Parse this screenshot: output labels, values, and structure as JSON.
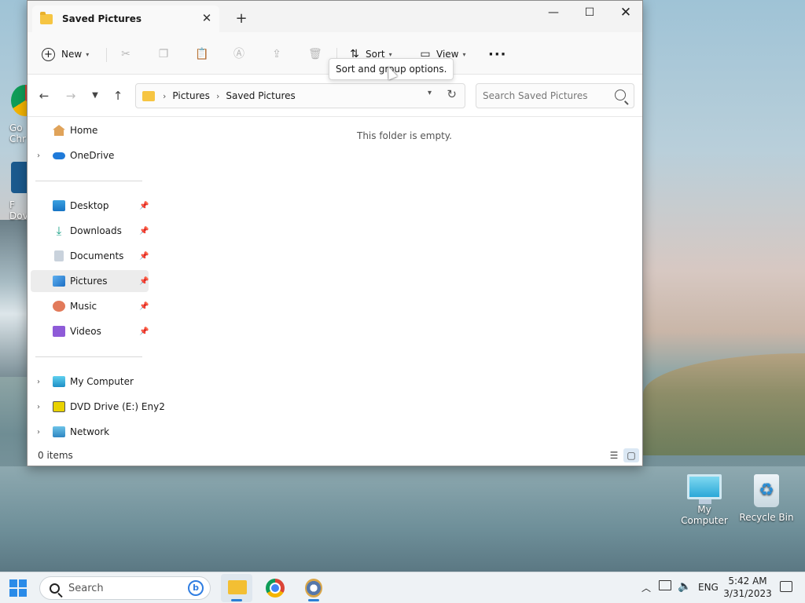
{
  "desktop": {
    "icons": [
      {
        "label": "My Computer"
      },
      {
        "label": "Recycle Bin"
      }
    ],
    "partial_icons": [
      {
        "label_line1": "Go",
        "label_line2": "Chr"
      },
      {
        "label_line1": "F",
        "label_line2": "Dov"
      }
    ]
  },
  "window": {
    "tab_title": "Saved Pictures",
    "new_tab_symbol": "+",
    "close_tab_symbol": "✕",
    "minimize_symbol": "—",
    "maximize_symbol": "☐",
    "close_symbol": "✕"
  },
  "toolbar": {
    "new_label": "New",
    "sort_label": "Sort",
    "view_label": "View",
    "more_label": "···",
    "tooltip": "Sort and group options."
  },
  "address": {
    "crumbs": [
      "Pictures",
      "Saved Pictures"
    ],
    "search_placeholder": "Search Saved Pictures"
  },
  "sidebar": {
    "items": [
      {
        "label": "Home"
      },
      {
        "label": "OneDrive"
      },
      {
        "label": "Desktop"
      },
      {
        "label": "Downloads"
      },
      {
        "label": "Documents"
      },
      {
        "label": "Pictures"
      },
      {
        "label": "Music"
      },
      {
        "label": "Videos"
      },
      {
        "label": "My Computer"
      },
      {
        "label": "DVD Drive (E:) Eny2"
      },
      {
        "label": "Network"
      }
    ]
  },
  "content": {
    "empty_message": "This folder is empty."
  },
  "status": {
    "item_count": "0 items"
  },
  "taskbar": {
    "search_label": "Search",
    "language": "ENG",
    "time": "5:42 AM",
    "date": "3/31/2023"
  },
  "colors": {
    "accent": "#2a7fd6",
    "folder": "#f6c542"
  }
}
